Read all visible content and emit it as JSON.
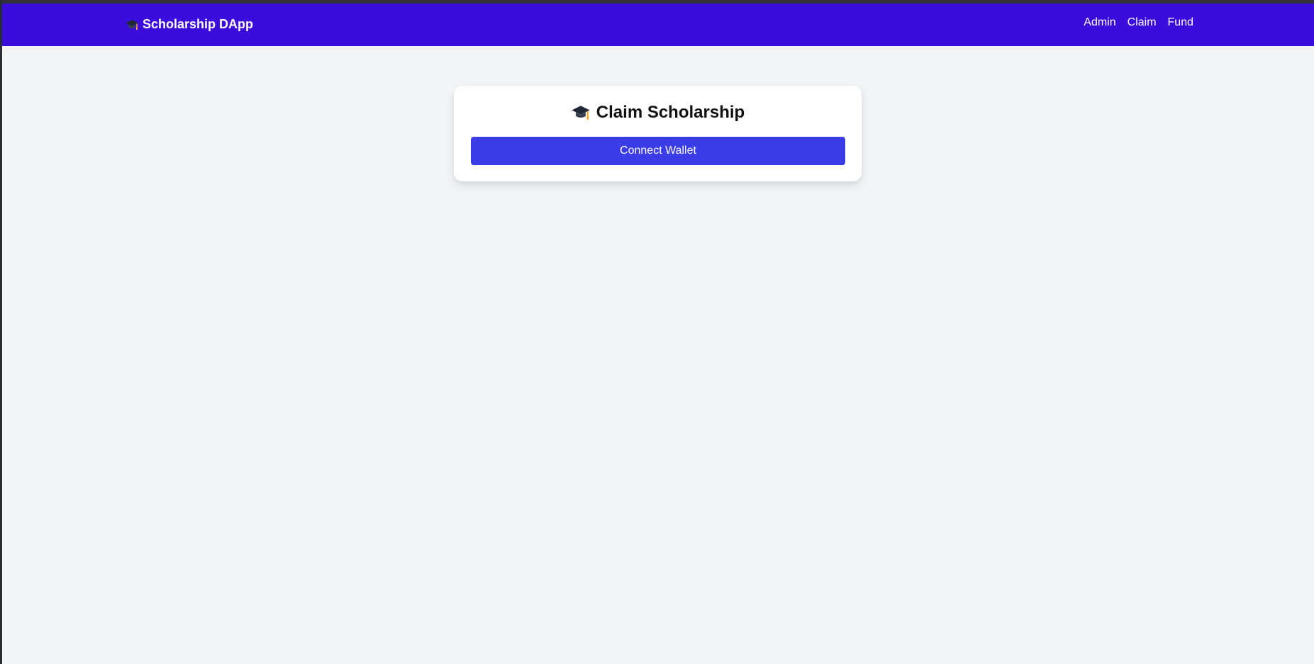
{
  "colors": {
    "navbar_bg": "#3b0ddd",
    "page_bg": "#f3f4f6",
    "button_bg": "#3a3ce8",
    "card_bg": "#ffffff"
  },
  "navbar": {
    "brand_icon": "graduation-cap-icon",
    "brand": "Scholarship DApp",
    "links": [
      {
        "label": "Admin"
      },
      {
        "label": "Claim"
      },
      {
        "label": "Fund"
      }
    ]
  },
  "card": {
    "title_icon": "graduation-cap-icon",
    "title": "Claim Scholarship",
    "connect_button": "Connect Wallet"
  }
}
